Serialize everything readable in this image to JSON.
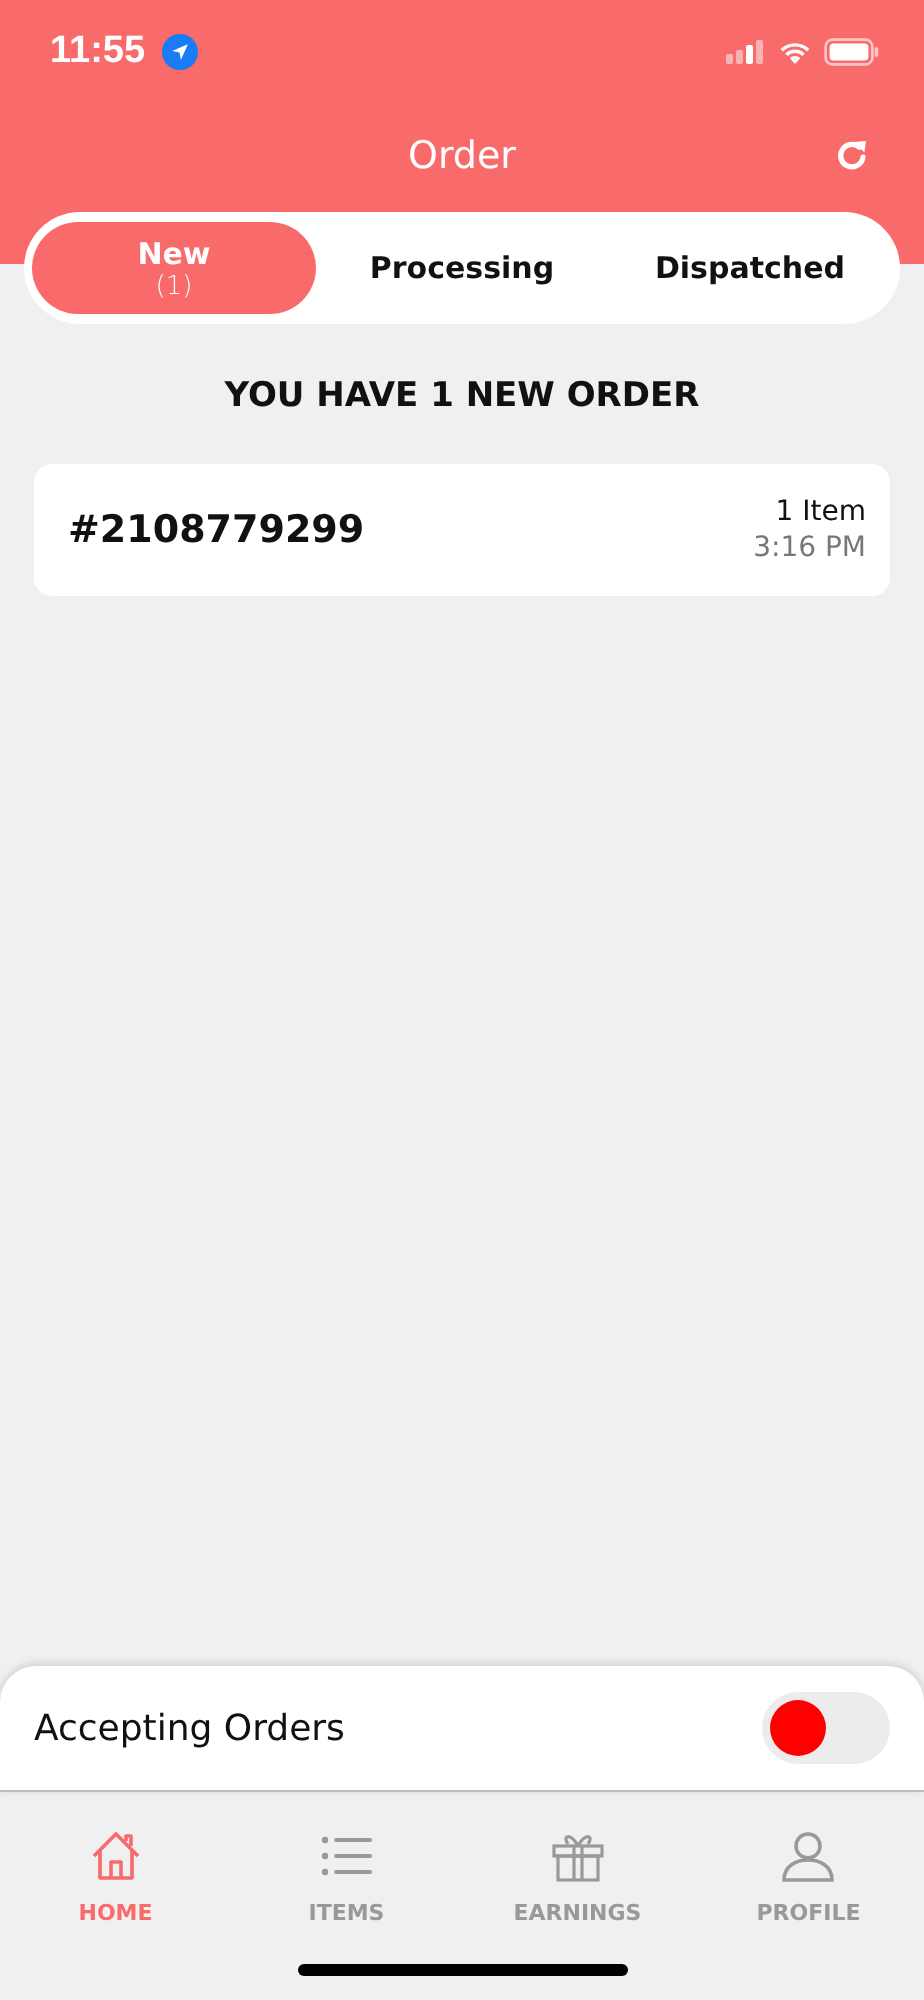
{
  "status_bar": {
    "time": "11:55"
  },
  "header": {
    "title": "Order"
  },
  "tabs": [
    {
      "label": "New",
      "count": "(1)",
      "selected": true
    },
    {
      "label": "Processing",
      "selected": false
    },
    {
      "label": "Dispatched",
      "selected": false
    }
  ],
  "heading": "YOU HAVE 1 NEW ORDER",
  "orders": [
    {
      "number": "#2108779299",
      "items": "1 Item",
      "time": "3:16 PM"
    }
  ],
  "accepting": {
    "label": "Accepting Orders",
    "on": false
  },
  "nav": [
    {
      "kind": "home",
      "label": "HOME",
      "selected": true
    },
    {
      "kind": "list",
      "label": "ITEMS",
      "selected": false
    },
    {
      "kind": "gift",
      "label": "EARNINGS",
      "selected": false
    },
    {
      "kind": "person",
      "label": "PROFILE",
      "selected": false
    }
  ]
}
